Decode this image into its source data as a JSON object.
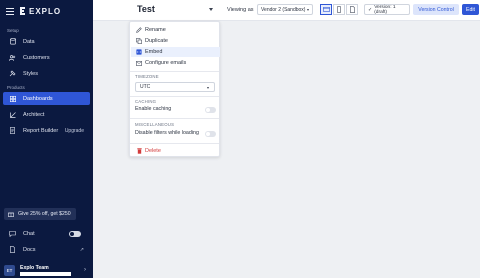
{
  "brand": {
    "name": "EXPLO"
  },
  "sidebar": {
    "setup_label": "Setup",
    "setup_items": [
      {
        "label": "Data",
        "icon": "database-icon"
      },
      {
        "label": "Customers",
        "icon": "users-icon"
      },
      {
        "label": "Styles",
        "icon": "palette-icon"
      }
    ],
    "products_label": "Products",
    "product_items": [
      {
        "label": "Dashboards",
        "icon": "dashboard-icon",
        "active": true
      },
      {
        "label": "Architect",
        "icon": "architect-icon"
      },
      {
        "label": "Report Builder",
        "icon": "report-icon",
        "trail": "Upgrade"
      }
    ],
    "promo": "Give 25% off, get $250",
    "chat_label": "Chat",
    "docs_label": "Docs",
    "user_name": "Explo Team",
    "user_initials": "ET"
  },
  "topbar": {
    "dashboard_title": "Test",
    "viewing_as_label": "Viewing as",
    "viewing_as_value": "Vendor 2 (Sandbox)",
    "version_label": "Version: 1 (draft)",
    "version_control_label": "Version Control",
    "edit_label": "Edit"
  },
  "menu": {
    "rename": "Rename",
    "duplicate": "Duplicate",
    "embed": "Embed",
    "configure_emails": "Configure emails",
    "timezone_heading": "TIMEZONE",
    "timezone_value": "UTC",
    "caching_heading": "CACHING",
    "enable_caching": "Enable caching",
    "misc_heading": "MISCELLANEOUS",
    "disable_filters": "Disable filters while loading",
    "delete": "Delete"
  },
  "colors": {
    "sidebar_bg": "#0b1940",
    "accent": "#2f56d6",
    "danger": "#d33b3b"
  }
}
